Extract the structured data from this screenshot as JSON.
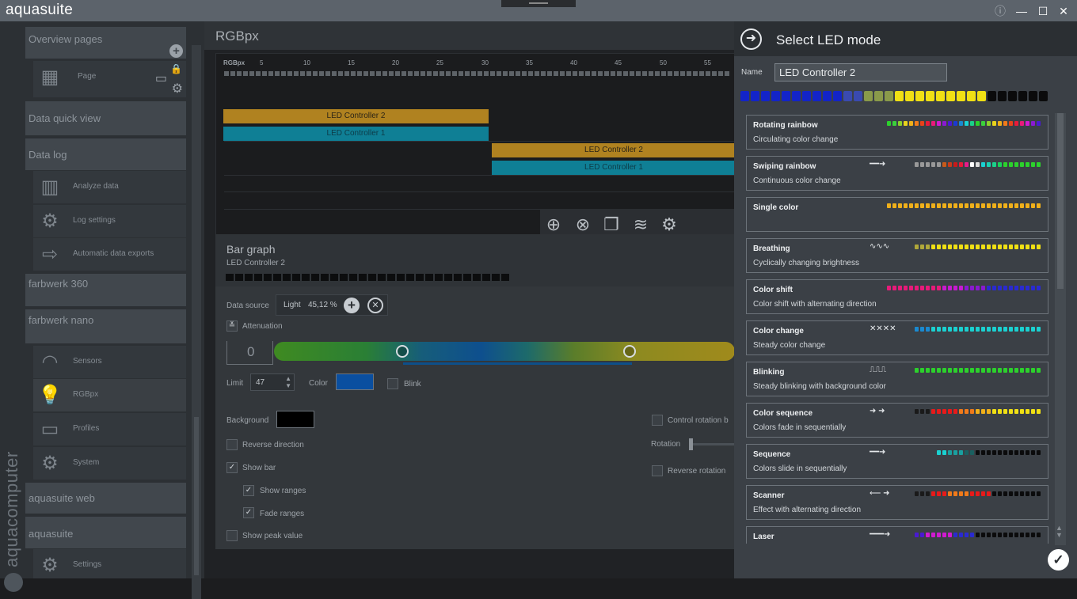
{
  "app": {
    "title": "aquasuite",
    "brand": "aquacomputer"
  },
  "window": {
    "info": "ⓘ",
    "minimize": "—",
    "maximize": "☐",
    "close": "✕"
  },
  "sidebar": {
    "sections": [
      {
        "label": "Overview pages"
      },
      {
        "label": "Data quick view"
      },
      {
        "label": "Data log"
      },
      {
        "label": "farbwerk 360"
      },
      {
        "label": "farbwerk nano"
      },
      {
        "label": "aquasuite web"
      },
      {
        "label": "aquasuite"
      }
    ],
    "items": [
      {
        "label": "Page",
        "icon": "page-grid-icon"
      },
      {
        "label": "Analyze data",
        "icon": "bar-chart-icon"
      },
      {
        "label": "Log settings",
        "icon": "gear-icon"
      },
      {
        "label": "Automatic data exports",
        "icon": "export-icon"
      },
      {
        "label": "Sensors",
        "icon": "gauge-icon"
      },
      {
        "label": "RGBpx",
        "icon": "bulb-icon"
      },
      {
        "label": "Profiles",
        "icon": "folder-icon"
      },
      {
        "label": "System",
        "icon": "gear-icon"
      },
      {
        "label": "Settings",
        "icon": "gear-icon"
      }
    ]
  },
  "main": {
    "title": "RGBpx",
    "ruler": {
      "label": "RGBpx",
      "ticks": [
        "5",
        "10",
        "15",
        "20",
        "25",
        "30",
        "35",
        "40",
        "45",
        "50",
        "55"
      ]
    },
    "tracks": [
      {
        "label": "LED Controller 2"
      },
      {
        "label": "LED Controller 1"
      },
      {
        "label": "LED Controller 2"
      },
      {
        "label": "LED Controller 1"
      }
    ]
  },
  "bar_graph": {
    "title": "Bar graph",
    "subtitle": "LED Controller 2",
    "data_source_label": "Data source",
    "data_source_name": "Light",
    "data_source_value": "45,12 %",
    "attenuation_label": "Attenuation",
    "range_start": "0",
    "limit_label": "Limit",
    "limit_value": "47",
    "color_label": "Color",
    "color_value": "#0a4fa0",
    "blink_label": "Blink",
    "background_label": "Background",
    "background_value": "#000000",
    "reverse_direction": "Reverse direction",
    "show_bar": "Show bar",
    "show_ranges": "Show ranges",
    "fade_ranges": "Fade ranges",
    "show_peak": "Show peak value",
    "control_rotation": "Control rotation b",
    "rotation_label": "Rotation",
    "reverse_rotation": "Reverse rotation",
    "checks": {
      "reverse_direction": false,
      "show_bar": true,
      "show_ranges": true,
      "fade_ranges": true,
      "show_peak": false,
      "blink": false,
      "control_rotation": false,
      "reverse_rotation": false
    }
  },
  "select_led_mode": {
    "title": "Select LED mode",
    "name_label": "Name",
    "name_value": "LED Controller 2",
    "modes": [
      {
        "title": "Rotating rainbow",
        "desc": "Circulating color change",
        "icon": ""
      },
      {
        "title": "Swiping rainbow",
        "desc": "Continuous color change",
        "icon": "━━➜"
      },
      {
        "title": "Single color",
        "desc": "",
        "icon": ""
      },
      {
        "title": "Breathing",
        "desc": "Cyclically changing brightness",
        "icon": "∿∿∿"
      },
      {
        "title": "Color shift",
        "desc": "Color shift with alternating direction",
        "icon": ""
      },
      {
        "title": "Color change",
        "desc": "Steady color change",
        "icon": "✕✕✕✕"
      },
      {
        "title": "Blinking",
        "desc": "Steady blinking with background color",
        "icon": "⎍⎍⎍"
      },
      {
        "title": "Color sequence",
        "desc": "Colors fade in sequentially",
        "icon": "➜ ➜"
      },
      {
        "title": "Sequence",
        "desc": "Colors slide in sequentially",
        "icon": "━━➜"
      },
      {
        "title": "Scanner",
        "desc": "Effect with alternating direction",
        "icon": "⟵ ➜"
      },
      {
        "title": "Laser",
        "desc": "",
        "icon": "━━━➜"
      }
    ],
    "confirm": "✓"
  }
}
